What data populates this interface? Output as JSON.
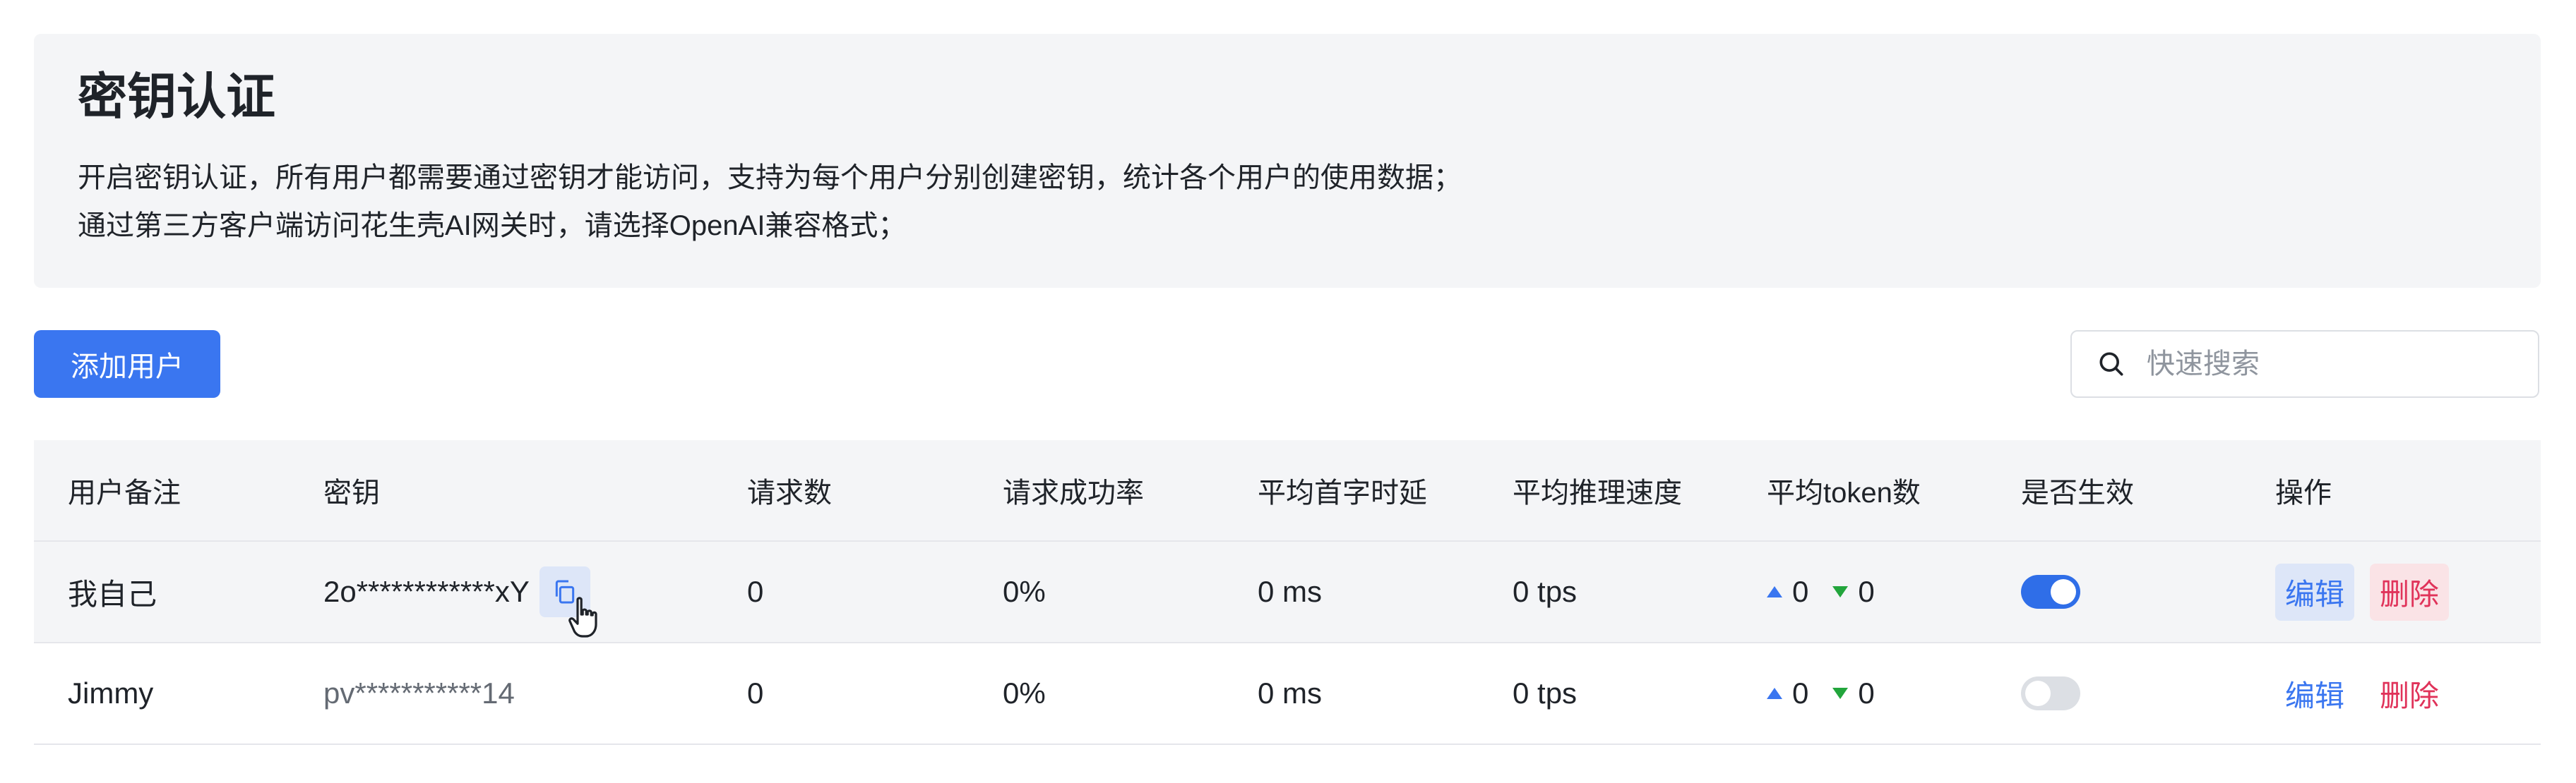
{
  "info": {
    "title": "密钥认证",
    "line1": "开启密钥认证，所有用户都需要通过密钥才能访问，支持为每个用户分别创建密钥，统计各个用户的使用数据；",
    "line2": "通过第三方客户端访问花生壳AI网关时，请选择OpenAI兼容格式；"
  },
  "toolbar": {
    "add_label": "添加用户",
    "search_placeholder": "快速搜索",
    "search_value": ""
  },
  "table": {
    "columns": [
      "用户备注",
      "密钥",
      "请求数",
      "请求成功率",
      "平均首字时延",
      "平均推理速度",
      "平均token数",
      "是否生效",
      "操作"
    ],
    "rows": [
      {
        "note": "我自己",
        "key": "2o************xY",
        "requests": "0",
        "success_rate": "0%",
        "latency": "0 ms",
        "speed": "0 tps",
        "tokens_up": "0",
        "tokens_down": "0",
        "enabled": true,
        "edit": "编辑",
        "delete": "删除"
      },
      {
        "note": "Jimmy",
        "key": "pv***********14",
        "requests": "0",
        "success_rate": "0%",
        "latency": "0 ms",
        "speed": "0 tps",
        "tokens_up": "0",
        "tokens_down": "0",
        "enabled": false,
        "edit": "编辑",
        "delete": "删除"
      }
    ]
  },
  "colors": {
    "accent": "#3a76f0",
    "danger": "#e0335a",
    "success": "#22a53c",
    "panel": "#f4f5f7"
  },
  "icons": {
    "search": "search-icon",
    "copy": "copy-icon",
    "cursor": "hand-pointer-cursor-icon",
    "up": "triangle-up-icon",
    "down": "triangle-down-icon"
  }
}
